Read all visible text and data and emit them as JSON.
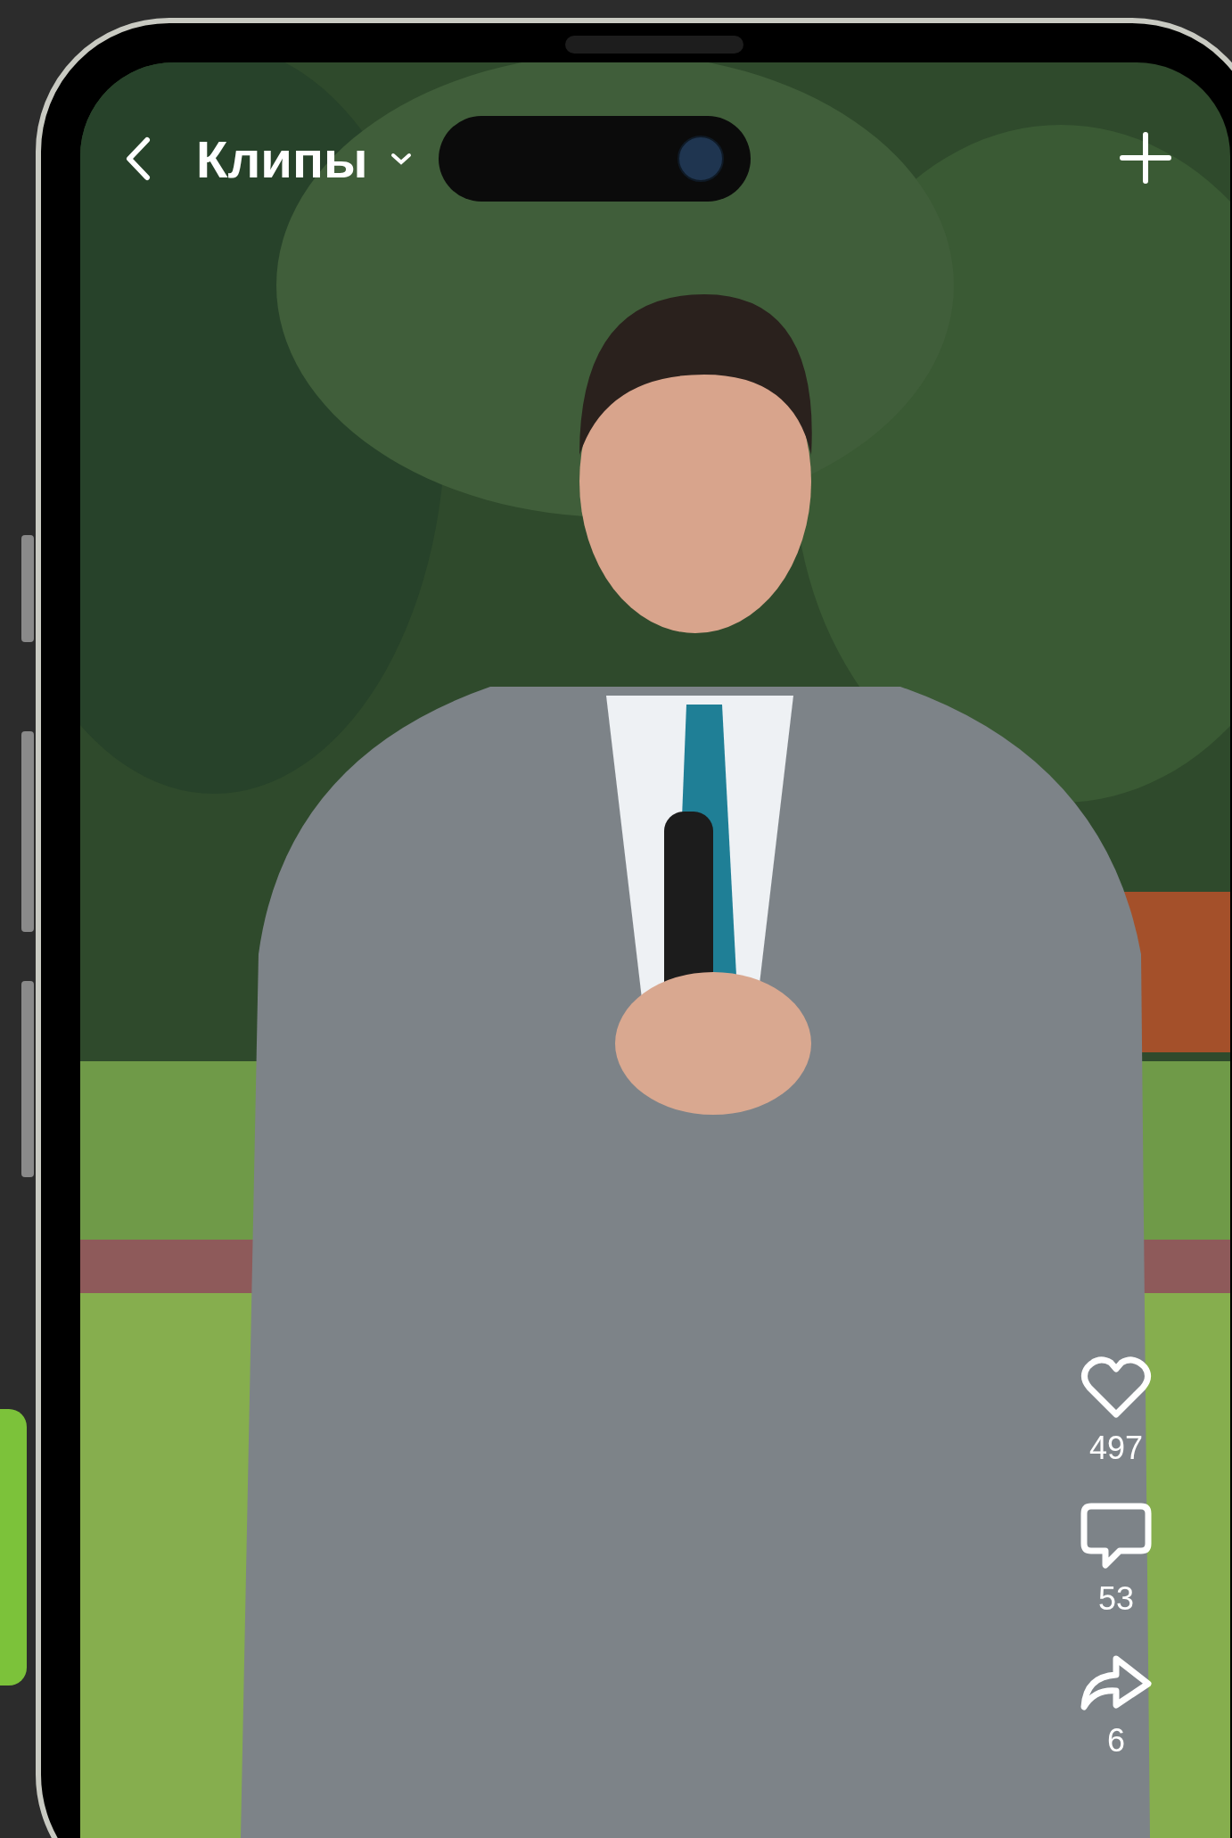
{
  "header": {
    "title": "Клипы"
  },
  "actions": [
    {
      "kind": "like",
      "count": "497"
    },
    {
      "kind": "comment",
      "count": "53"
    },
    {
      "kind": "share",
      "count": "6"
    }
  ]
}
